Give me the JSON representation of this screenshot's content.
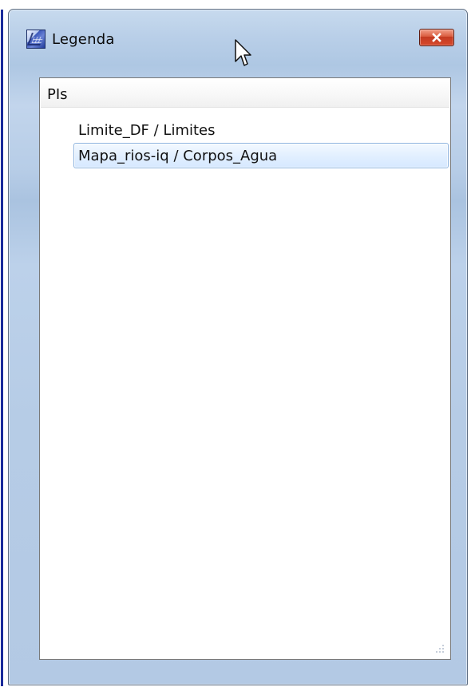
{
  "window": {
    "title": "Legenda",
    "icons": {
      "app": "app-icon",
      "close": "close-icon",
      "cursor": "pointer-cursor-icon",
      "resize": "resize-grip-icon"
    }
  },
  "panel": {
    "section_title": "PIs",
    "items": [
      {
        "label": "Limite_DF / Limites",
        "selected": false
      },
      {
        "label": "Mapa_rios-iq / Corpos_Agua",
        "selected": true
      }
    ]
  }
}
